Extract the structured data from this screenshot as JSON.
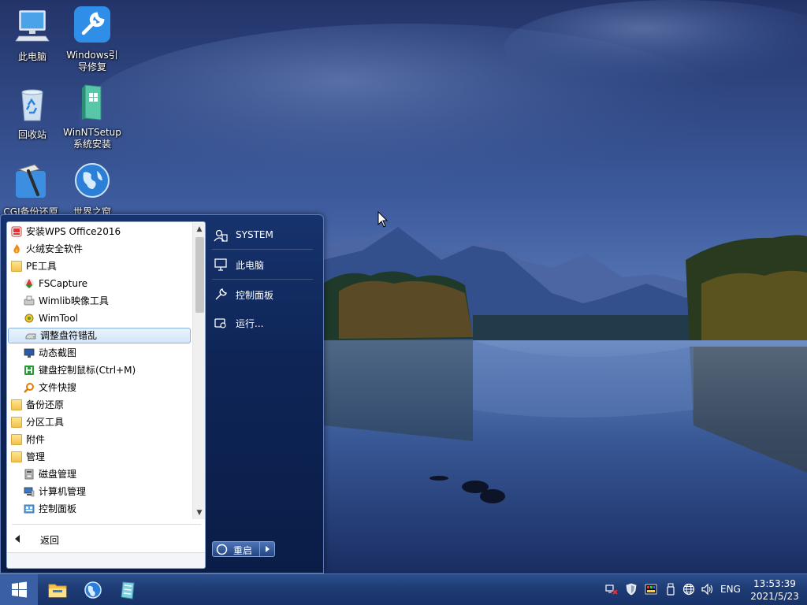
{
  "desktop": {
    "icons": [
      {
        "label": "此电脑"
      },
      {
        "label_line1": "Windows引",
        "label_line2": "导修复"
      },
      {
        "label": "回收站"
      },
      {
        "label_line1": "WinNTSetup",
        "label_line2": "系统安装"
      },
      {
        "label": "CGI备份还原"
      },
      {
        "label": "世界之窗"
      }
    ]
  },
  "start_menu": {
    "programs": [
      {
        "label": "安装WPS Office2016",
        "icon": "wps-icon"
      },
      {
        "label": "火绒安全软件",
        "icon": "huorong-icon"
      },
      {
        "label": "PE工具",
        "icon": "folder-icon"
      },
      {
        "label": "FSCapture",
        "icon": "fscapture-icon"
      },
      {
        "label": "Wimlib映像工具",
        "icon": "wimlib-icon"
      },
      {
        "label": "WimTool",
        "icon": "wimtool-icon"
      },
      {
        "label": "调整盘符错乱",
        "icon": "drive-icon",
        "selected": true
      },
      {
        "label": "动态截图",
        "icon": "screen-capture-icon"
      },
      {
        "label": "键盘控制鼠标(Ctrl+M)",
        "icon": "keyboard-mouse-icon"
      },
      {
        "label": "文件快搜",
        "icon": "file-search-icon"
      },
      {
        "label": "备份还原",
        "icon": "folder-icon"
      },
      {
        "label": "分区工具",
        "icon": "folder-icon"
      },
      {
        "label": "附件",
        "icon": "folder-icon"
      },
      {
        "label": "管理",
        "icon": "folder-icon"
      },
      {
        "label": "磁盘管理",
        "icon": "disk-management-icon"
      },
      {
        "label": "计算机管理",
        "icon": "computer-management-icon"
      },
      {
        "label": "控制面板",
        "icon": "control-panel-icon"
      }
    ],
    "back_label": "返回",
    "right_pane": [
      {
        "label": "SYSTEM",
        "icon": "user-icon"
      },
      {
        "label": "此电脑",
        "icon": "computer-icon"
      },
      {
        "label": "控制面板",
        "icon": "wrench-icon"
      },
      {
        "label": "运行...",
        "icon": "run-icon"
      }
    ],
    "restart_label": "重启"
  },
  "taskbar": {
    "apps": [
      {
        "icon": "file-explorer-icon"
      },
      {
        "icon": "browser-globe-icon"
      },
      {
        "icon": "setup-tool-icon"
      }
    ],
    "tray": {
      "icons": [
        "network-disconnect-icon",
        "shield-icon",
        "display-color-icon",
        "usb-drive-icon",
        "globe-network-icon",
        "volume-icon"
      ],
      "language": "ENG",
      "time": "13:53:39",
      "date": "2021/5/23"
    }
  }
}
